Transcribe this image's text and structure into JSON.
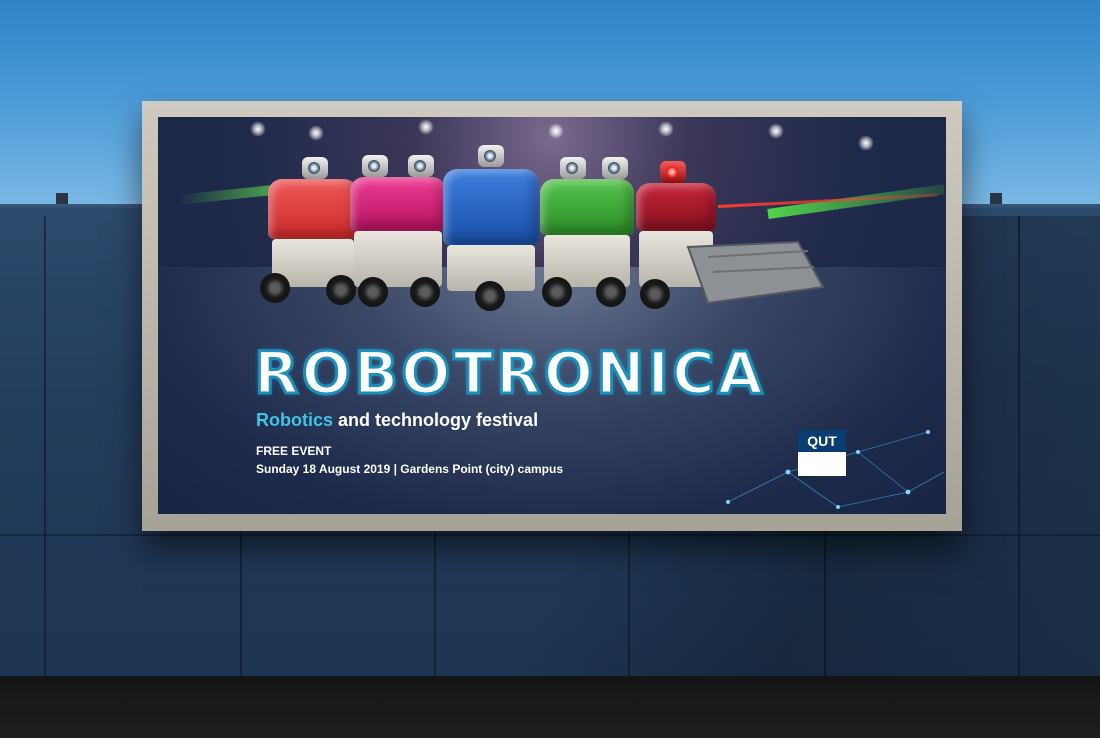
{
  "poster": {
    "title": "ROBOTRONICA",
    "subtitle_highlight": "Robotics",
    "subtitle_rest": "and technology festival",
    "free_event": "FREE EVENT",
    "date_location": "Sunday 18 August 2019  |  Gardens Point (city) campus",
    "logo_text": "QUT"
  },
  "colors": {
    "title_outline": "#1d8fb8",
    "subtitle_accent": "#3fc3e6",
    "logo_blue": "#0a3e72",
    "robot_red": "#e23b3b",
    "robot_magenta": "#d81b7a",
    "robot_blue": "#1f5fc4",
    "robot_green": "#3fae3a",
    "robot_darkred": "#a8182b"
  }
}
